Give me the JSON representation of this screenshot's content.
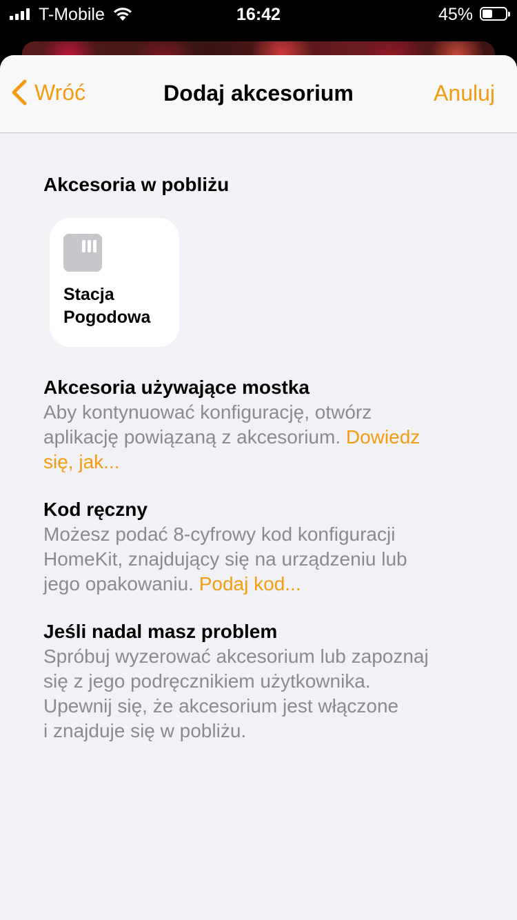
{
  "status_bar": {
    "carrier": "T-Mobile",
    "time": "16:42",
    "battery_percent": "45%",
    "battery_level": 0.45
  },
  "nav": {
    "back_label": "Wróć",
    "title": "Dodaj akcesorium",
    "cancel_label": "Anuluj"
  },
  "nearby": {
    "heading": "Akcesoria w pobliżu",
    "items": [
      {
        "line1": "Stacja",
        "line2": "Pogodowa",
        "icon": "accessory-icon"
      }
    ]
  },
  "bridge": {
    "heading": "Akcesoria używające mostka",
    "line1": "Aby kontynuować konfigurację, otwórz",
    "line2_text": "aplikację powiązaną z akcesorium. ",
    "line2_link": "Dowiedz",
    "line3_link": "się, jak..."
  },
  "manual": {
    "heading": "Kod ręczny",
    "line1": "Możesz podać 8-cyfrowy kod konfiguracji",
    "line2": "HomeKit, znajdujący się na urządzeniu lub",
    "line3_text": "jego opakowaniu. ",
    "line3_link": "Podaj kod..."
  },
  "trouble": {
    "heading": "Jeśli nadal masz problem",
    "line1": "Spróbuj wyzerować akcesorium lub zapoznaj",
    "line2": "się z jego podręcznikiem użytkownika.",
    "line3": "Upewnij się, że akcesorium jest włączone",
    "line4": "i znajduje się w pobliżu."
  },
  "colors": {
    "accent": "#f39c12",
    "secondary_text": "#8a8a8f",
    "background": "#f2f1f6"
  }
}
